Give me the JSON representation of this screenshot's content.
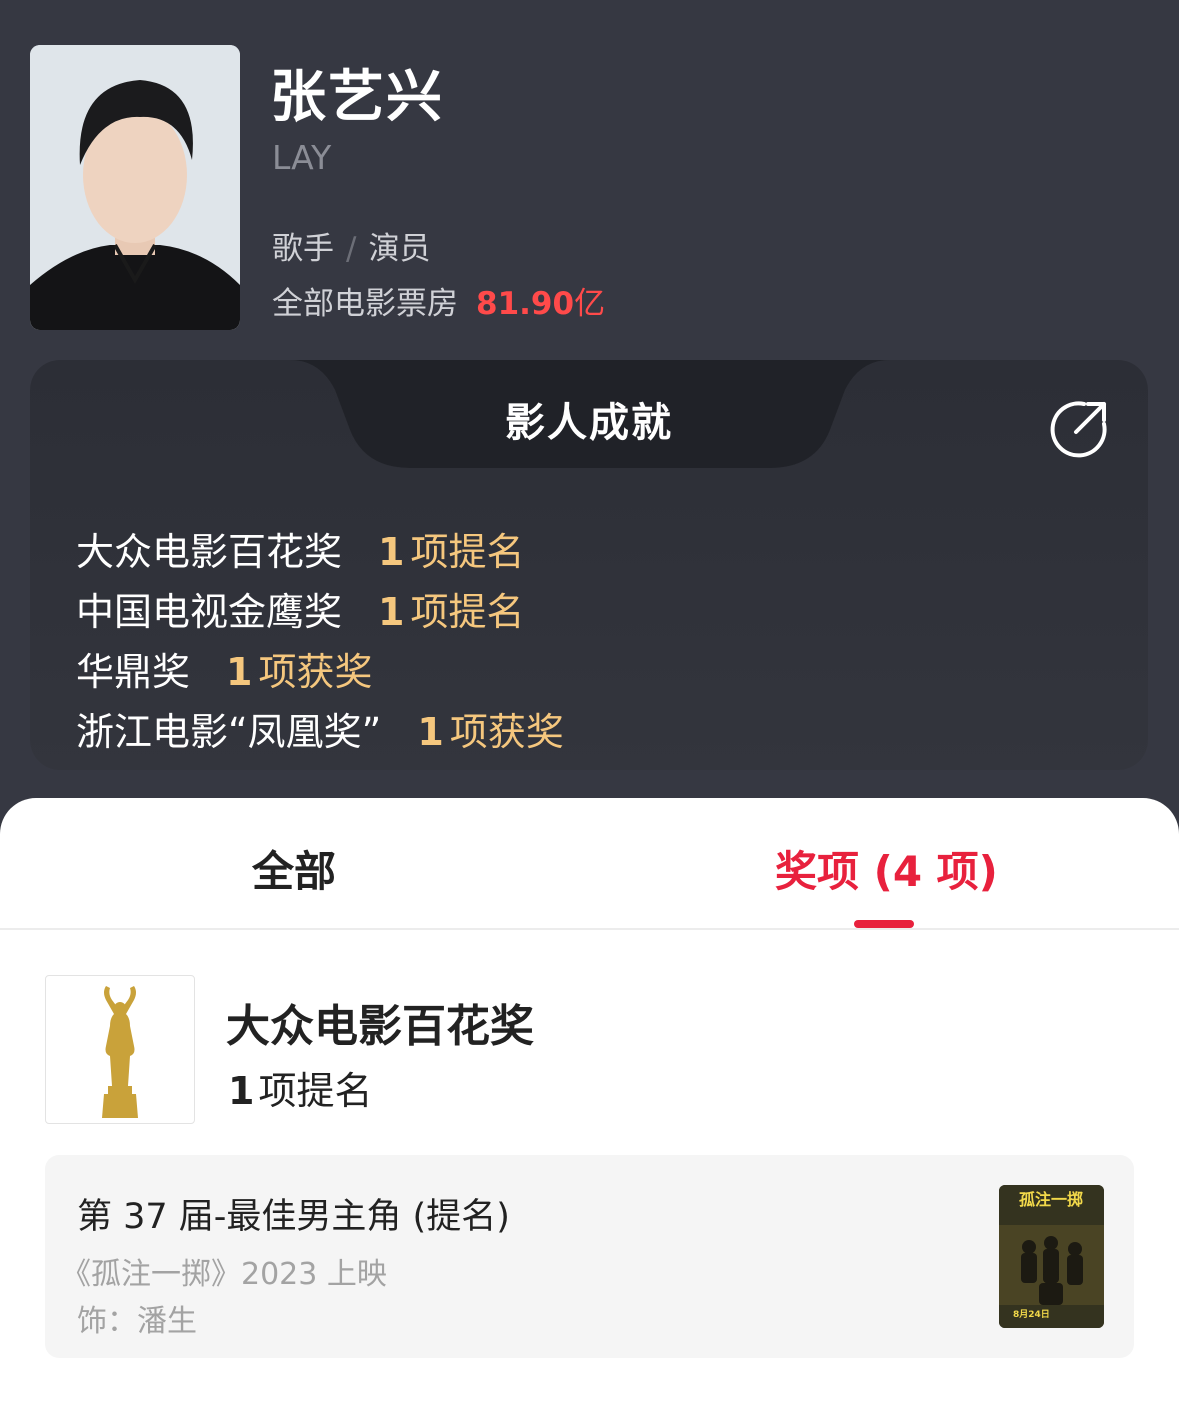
{
  "profile": {
    "name": "张艺兴",
    "english_name": "LAY",
    "roles": [
      "歌手",
      "演员"
    ],
    "role_separator": "/",
    "box_office_label": "全部电影票房",
    "box_office_value": "81.90",
    "box_office_unit": "亿"
  },
  "achievements": {
    "title": "影人成就",
    "share_icon": "share-icon",
    "items": [
      {
        "award": "大众电影百花奖",
        "count": "1",
        "type": "项提名"
      },
      {
        "award": "中国电视金鹰奖",
        "count": "1",
        "type": "项提名"
      },
      {
        "award": "华鼎奖",
        "count": "1",
        "type": "项获奖"
      },
      {
        "award": "浙江电影“凤凰奖”",
        "count": "1",
        "type": "项获奖"
      }
    ]
  },
  "tabs": {
    "all": "全部",
    "awards": "奖项 (4 项)",
    "active": "awards"
  },
  "award_section": {
    "trophy_icon": "trophy-icon",
    "name": "大众电影百花奖",
    "count": "1",
    "count_label": "项提名",
    "nominations": [
      {
        "title": "第 37 届-最佳男主角 (提名)",
        "film": "《孤注一掷》2023 上映",
        "role": "饰：潘生",
        "poster_title": "孤注一掷",
        "poster_date": "8月24日"
      }
    ]
  },
  "colors": {
    "accent": "#e8213d",
    "gold": "#f5c77e",
    "box_office": "#ff4a4a",
    "dark_bg": "#363842"
  }
}
